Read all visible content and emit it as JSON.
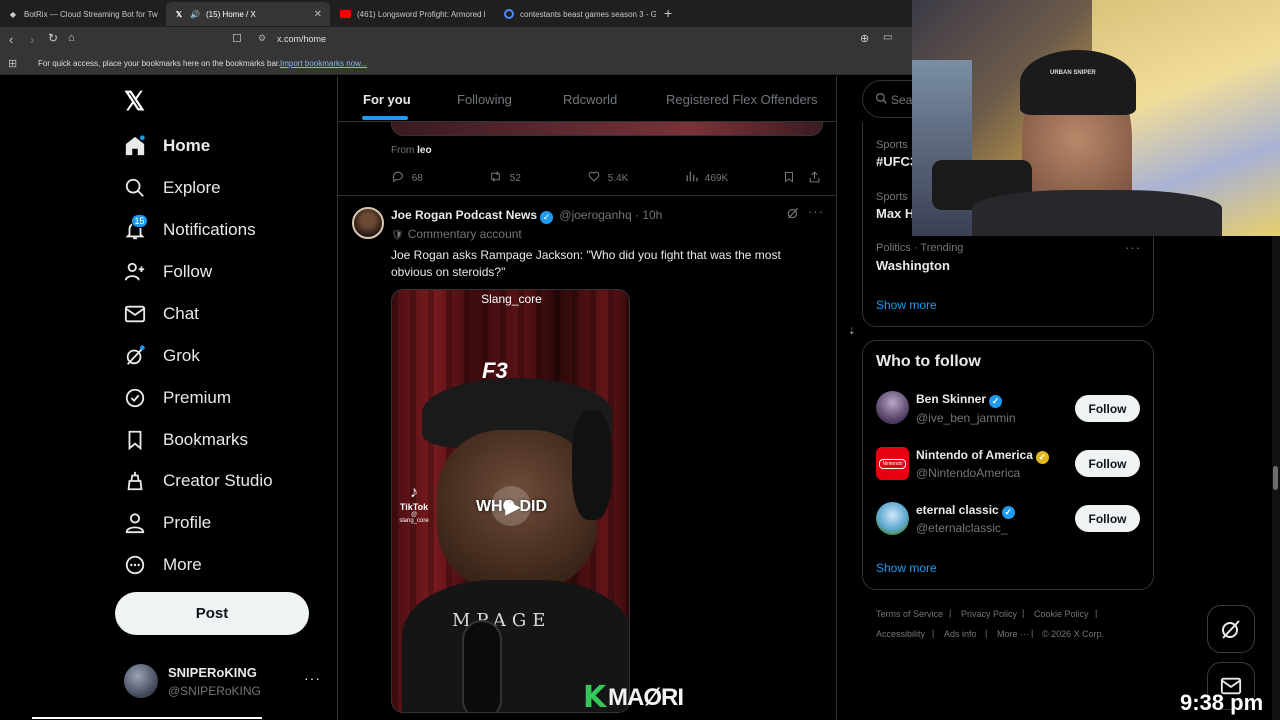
{
  "browser": {
    "tabs": [
      {
        "title": "BotRix — Cloud Streaming Bot for Tw",
        "fav_color": "#cccccc"
      },
      {
        "title": "(15) Home / X",
        "fav_color": "#ffffff"
      },
      {
        "title": "(461) Longsword Profight: Armored l",
        "fav_color": "#ff2020"
      },
      {
        "title": "contestants beast games season 3 - G",
        "fav_color": "#4c8bf5"
      }
    ],
    "url": "x.com/home",
    "bookmarks_text": "For quick access, place your bookmarks here on the bookmarks bar.",
    "bookmarks_link": "Import bookmarks now..."
  },
  "sidebar": {
    "items": [
      {
        "label": "Home",
        "icon": "home-icon"
      },
      {
        "label": "Explore",
        "icon": "search-icon"
      },
      {
        "label": "Notifications",
        "icon": "bell-icon",
        "badge": "15"
      },
      {
        "label": "Follow",
        "icon": "person-plus-icon"
      },
      {
        "label": "Chat",
        "icon": "envelope-icon"
      },
      {
        "label": "Grok",
        "icon": "grok-icon"
      },
      {
        "label": "Premium",
        "icon": "premium-icon"
      },
      {
        "label": "Bookmarks",
        "icon": "bookmark-icon"
      },
      {
        "label": "Creator Studio",
        "icon": "creator-studio-icon"
      },
      {
        "label": "Profile",
        "icon": "person-icon"
      },
      {
        "label": "More",
        "icon": "more-circle-icon"
      }
    ],
    "post_label": "Post",
    "account": {
      "name": "SNIPERoKING",
      "handle": "@SNIPERoKING"
    }
  },
  "home_tabs": [
    "For you",
    "Following",
    "Rdcworld",
    "Registered Flex Offenders"
  ],
  "prev_post": {
    "from_label": "From",
    "from_name": "leo",
    "stats": {
      "replies": "68",
      "reposts": "52",
      "likes": "5.4K",
      "views": "469K"
    }
  },
  "post": {
    "author": "Joe Rogan Podcast News",
    "handle": "@joeroganhq",
    "time": "10h",
    "label": "Commentary account",
    "text": "Joe Rogan asks Rampage Jackson: \"Who did you fight that was the most obvious on steroids?\"",
    "video": {
      "watermark": "Slang_core",
      "tiktok": "TikTok",
      "tiktok_user": "@ slang_core",
      "caption": "WHO DID",
      "shirt_text": "MPAGE",
      "hat_text": "F3"
    }
  },
  "right": {
    "search_placeholder": "Search",
    "trends": [
      {
        "category": "Sports · Trending",
        "name": "#UFC3"
      },
      {
        "category": "Sports · Trending",
        "name": "Max H"
      },
      {
        "category": "Politics · Trending",
        "name": "Washington"
      }
    ],
    "show_more": "Show more",
    "who_to_follow": {
      "title": "Who to follow",
      "accounts": [
        {
          "name": "Ben Skinner",
          "handle": "@ive_ben_jammin",
          "verified": "blue"
        },
        {
          "name": "Nintendo of America",
          "handle": "@NintendoAmerica",
          "verified": "gold"
        },
        {
          "name": "eternal classic",
          "handle": "@eternalclassic_",
          "verified": "blue"
        }
      ],
      "follow_label": "Follow",
      "show_more": "Show more"
    },
    "footer": [
      "Terms of Service",
      "Privacy Policy",
      "Cookie Policy",
      "Accessibility",
      "Ads info",
      "More ···",
      "© 2026 X Corp."
    ]
  },
  "overlay": {
    "clock": "9:38 pm",
    "webcam_hat_text": "URBAN SNIPER",
    "maori_text": "MAØRI"
  },
  "colors": {
    "accent": "#1d9bf0",
    "gold": "#e2b719",
    "bg": "#000000",
    "border": "#2f3336",
    "muted": "#71767b"
  }
}
